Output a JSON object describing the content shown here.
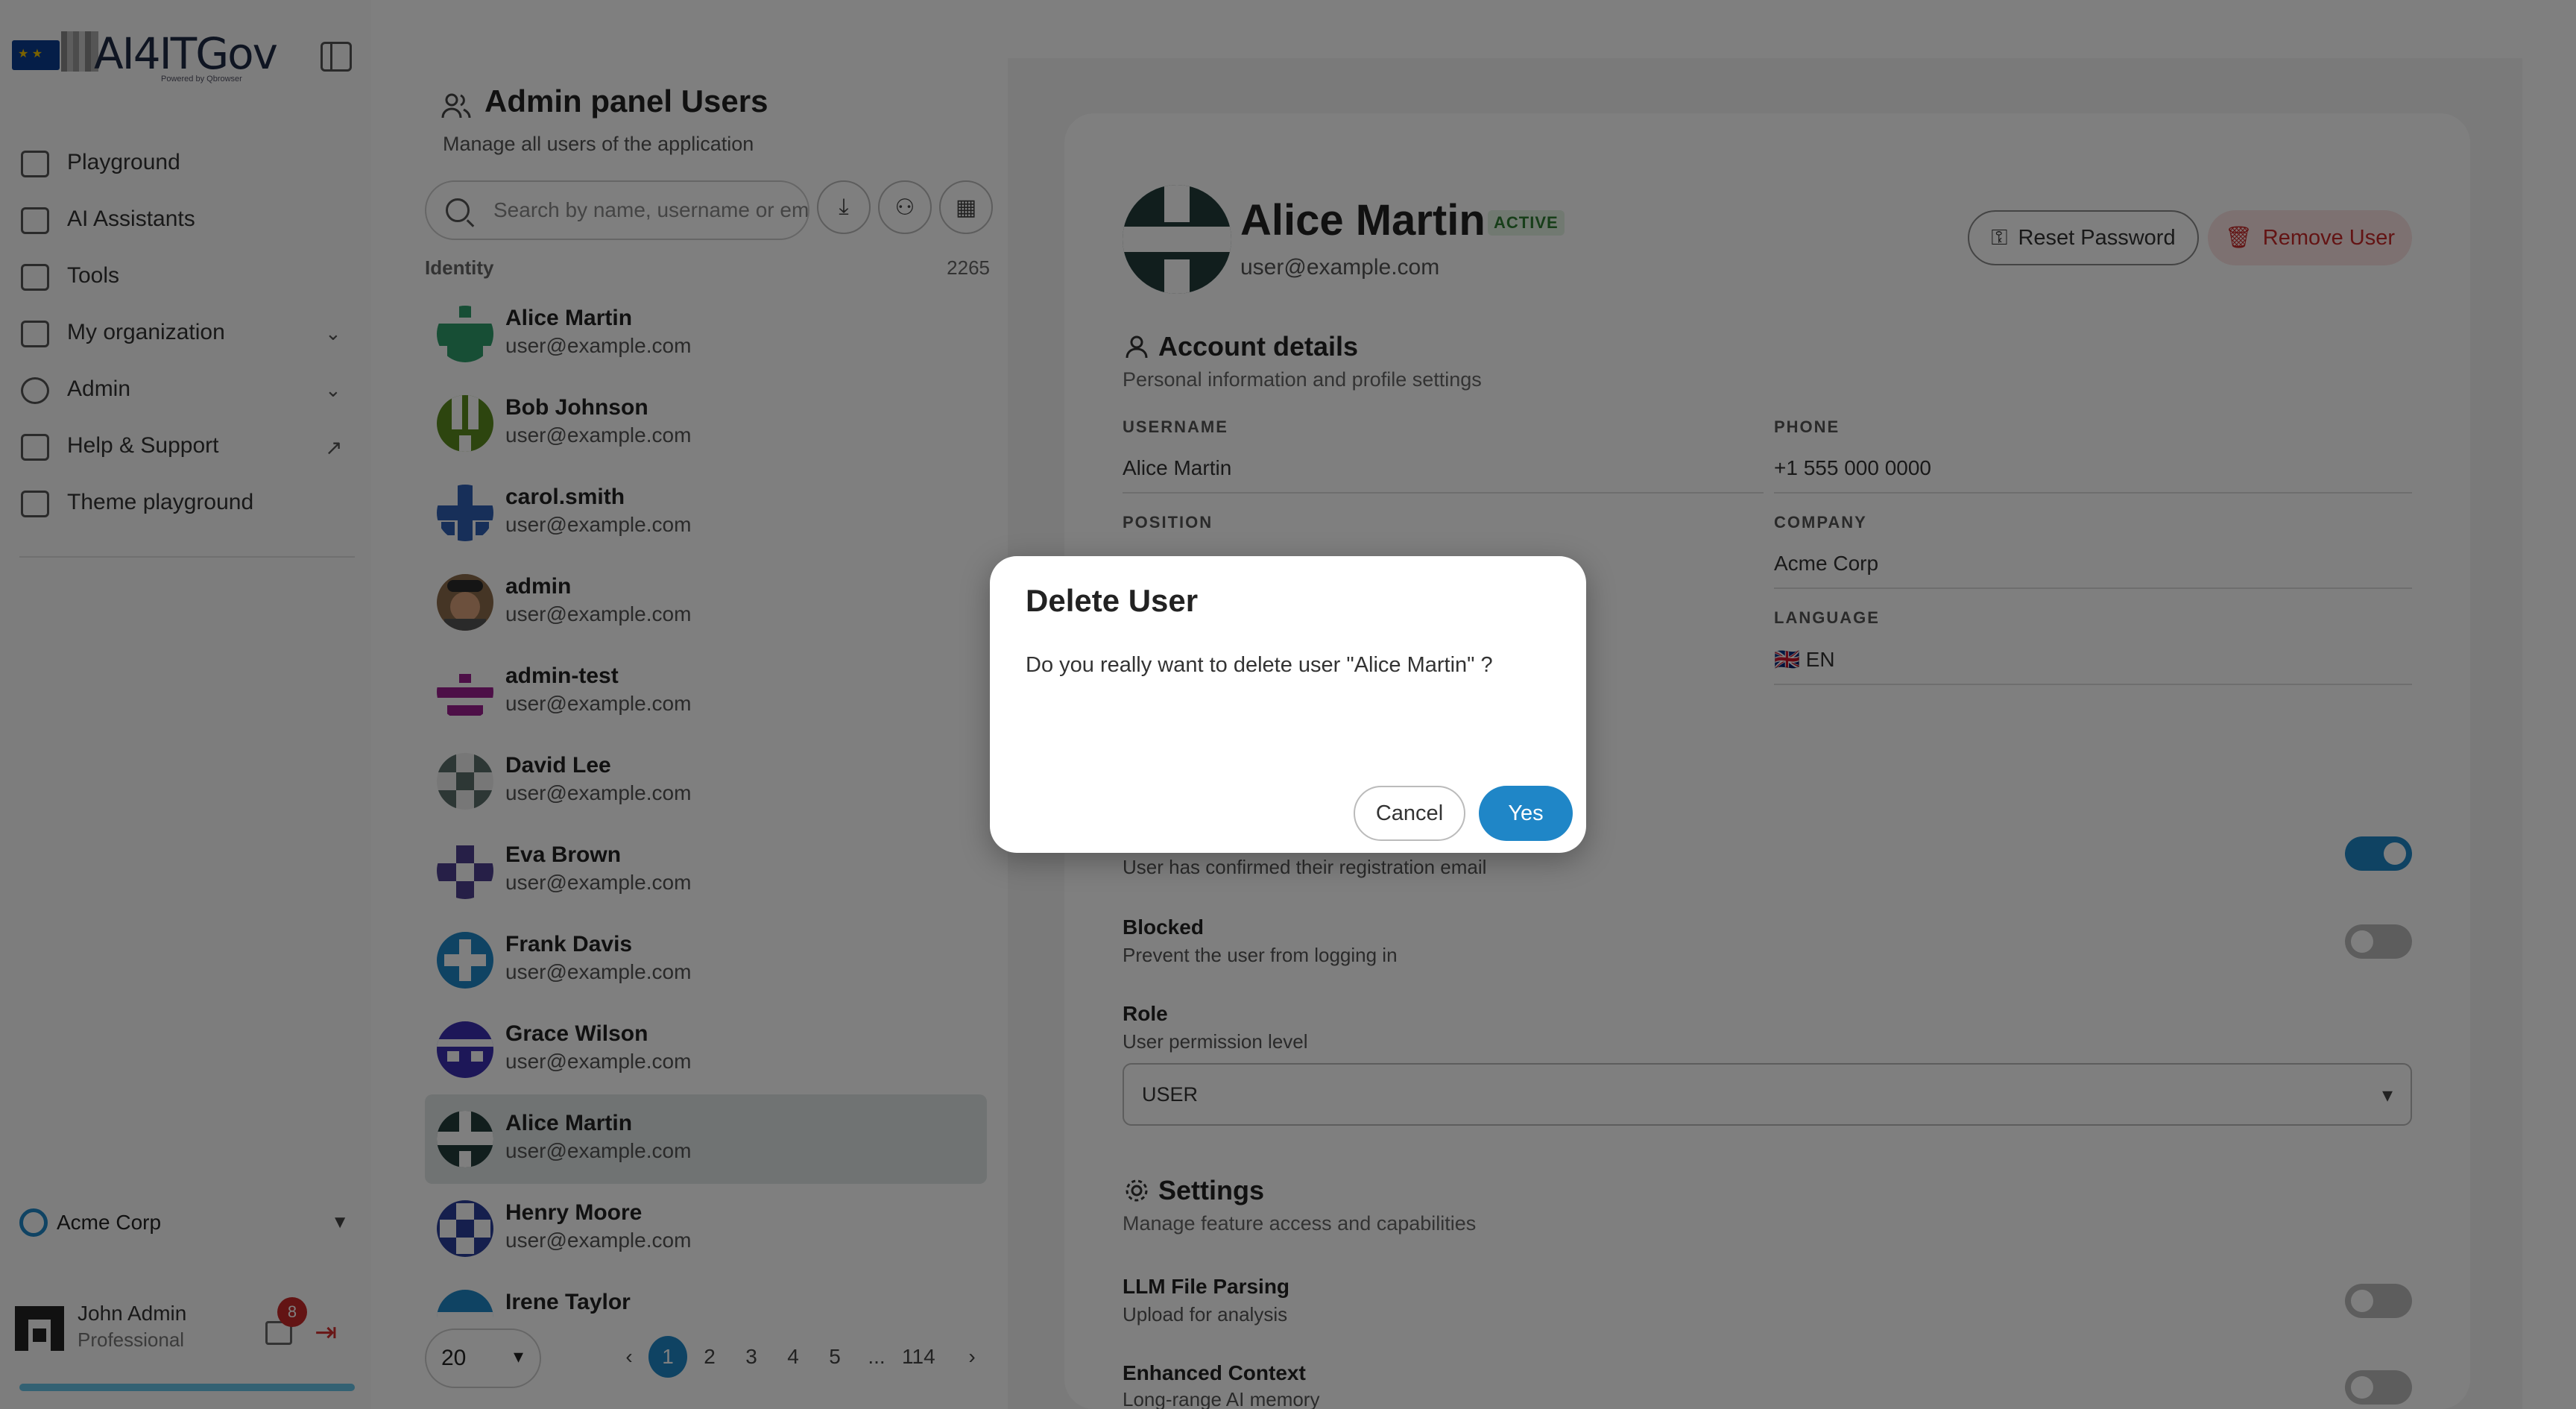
{
  "sidebar": {
    "logo_text": "AI4ITGov",
    "logo_sub": "Powered by Qbrowser",
    "nav": [
      {
        "label": "Playground",
        "icon": "grid-icon"
      },
      {
        "label": "AI Assistants",
        "icon": "robot-icon"
      },
      {
        "label": "Tools",
        "icon": "toolbox-icon"
      },
      {
        "label": "My organization",
        "icon": "building-icon"
      },
      {
        "label": "Admin",
        "icon": "shield-icon"
      },
      {
        "label": "Help & Support",
        "icon": "book-icon"
      },
      {
        "label": "Theme playground",
        "icon": "paintbrush-icon"
      }
    ],
    "org": "Acme Corp",
    "user_name": "John Admin",
    "user_role": "Professional",
    "notifications": "8"
  },
  "users_panel": {
    "title": "Admin panel Users",
    "subtitle": "Manage all users of the application",
    "search_placeholder": "Search by name, username or email",
    "column_header": "Identity",
    "total_count": "2265",
    "users": [
      {
        "name": "Alice Martin",
        "email": "user@example.com"
      },
      {
        "name": "Bob Johnson",
        "email": "user@example.com"
      },
      {
        "name": "carol.smith",
        "email": "user@example.com"
      },
      {
        "name": "admin",
        "email": "user@example.com"
      },
      {
        "name": "admin-test",
        "email": "user@example.com"
      },
      {
        "name": "David Lee",
        "email": "user@example.com"
      },
      {
        "name": "Eva Brown",
        "email": "user@example.com"
      },
      {
        "name": "Frank Davis",
        "email": "user@example.com"
      },
      {
        "name": "Grace Wilson",
        "email": "user@example.com"
      },
      {
        "name": "Alice Martin",
        "email": "user@example.com"
      },
      {
        "name": "Henry Moore",
        "email": "user@example.com"
      },
      {
        "name": "Irene Taylor",
        "email": ""
      }
    ],
    "page_size": "20",
    "pages": [
      "1",
      "2",
      "3",
      "4",
      "5",
      "...",
      "114"
    ],
    "current_page": "1"
  },
  "detail": {
    "name": "Alice Martin",
    "status": "ACTIVE",
    "email": "user@example.com",
    "reset_label": "Reset Password",
    "remove_label": "Remove User",
    "account_title": "Account details",
    "account_sub": "Personal information and profile settings",
    "username_label": "USERNAME",
    "username_value": "Alice Martin",
    "phone_label": "PHONE",
    "phone_value": "+1 555 000 0000",
    "position_label": "POSITION",
    "company_label": "COMPANY",
    "company_value": "Acme Corp",
    "language_label": "LANGUAGE",
    "language_value": "🇬🇧 EN",
    "email_confirmed_sub": "User has confirmed their registration email",
    "blocked_title": "Blocked",
    "blocked_sub": "Prevent the user from logging in",
    "role_title": "Role",
    "role_sub": "User permission level",
    "role_value": "USER",
    "settings_title": "Settings",
    "settings_sub": "Manage feature access and capabilities",
    "llm_title": "LLM File Parsing",
    "llm_sub": "Upload for analysis",
    "enh_title": "Enhanced Context",
    "enh_sub": "Long-range AI memory"
  },
  "modal": {
    "title": "Delete User",
    "body": "Do you really want to delete user \"Alice Martin\" ?",
    "cancel": "Cancel",
    "yes": "Yes"
  },
  "colors": {
    "accent": "#1f86c7",
    "danger": "#c62828",
    "success": "#2e7d32"
  }
}
